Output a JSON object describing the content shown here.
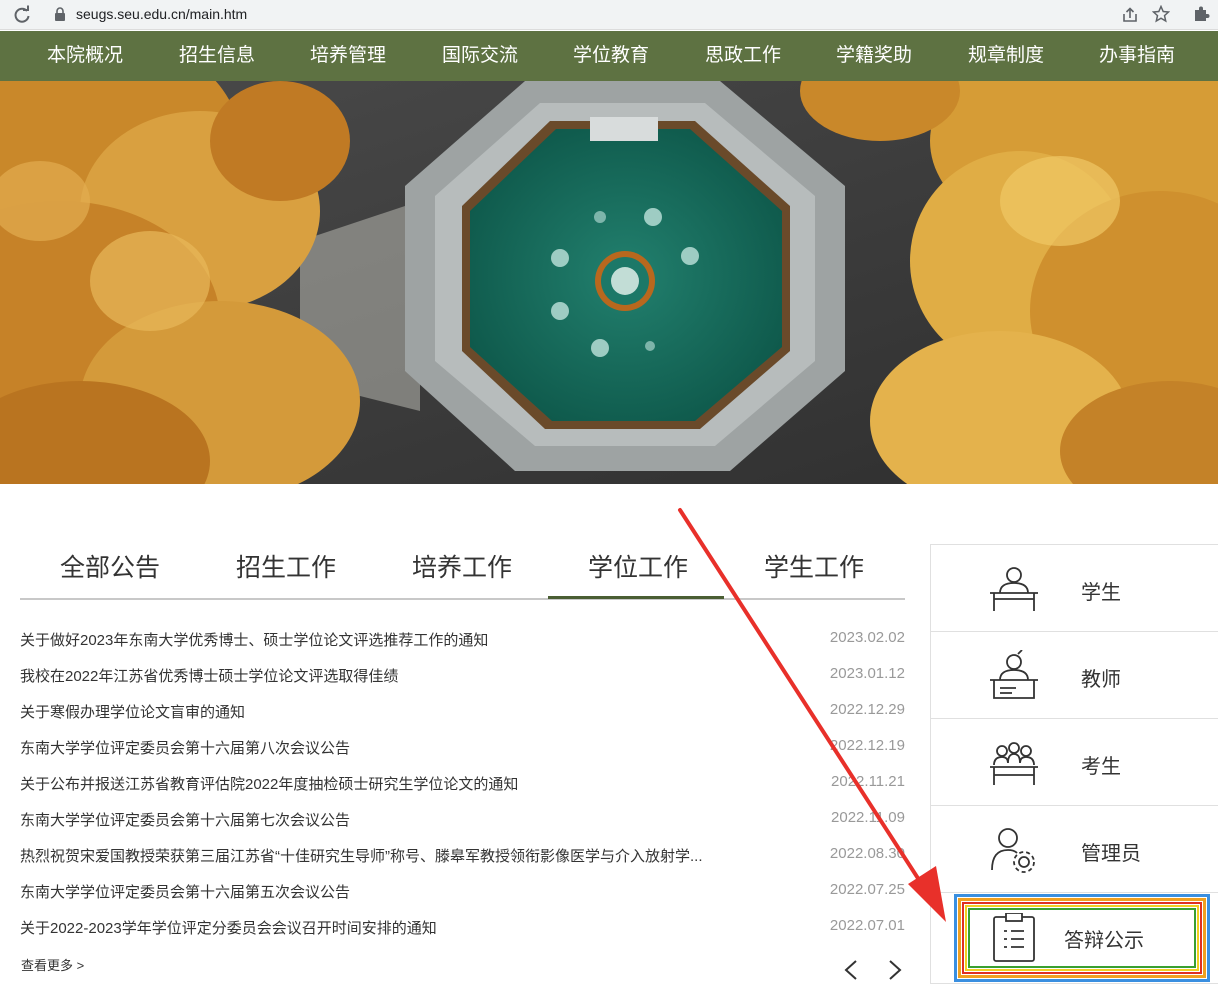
{
  "browser": {
    "url": "seugs.seu.edu.cn/main.htm"
  },
  "nav": {
    "items": [
      "本院概况",
      "招生信息",
      "培养管理",
      "国际交流",
      "学位教育",
      "思政工作",
      "学籍奖助",
      "规章制度",
      "办事指南"
    ]
  },
  "tabs": {
    "items": [
      "全部公告",
      "招生工作",
      "培养工作",
      "学位工作",
      "学生工作"
    ],
    "active": "学位工作"
  },
  "notices": {
    "items": [
      {
        "title": "关于做好2023年东南大学优秀博士、硕士学位论文评选推荐工作的通知",
        "date": "2023.02.02"
      },
      {
        "title": "我校在2022年江苏省优秀博士硕士学位论文评选取得佳绩",
        "date": "2023.01.12"
      },
      {
        "title": "关于寒假办理学位论文盲审的通知",
        "date": "2022.12.29"
      },
      {
        "title": "东南大学学位评定委员会第十六届第八次会议公告",
        "date": "2022.12.19"
      },
      {
        "title": "关于公布并报送江苏省教育评估院2022年度抽检硕士研究生学位论文的通知",
        "date": "2022.11.21"
      },
      {
        "title": "东南大学学位评定委员会第十六届第七次会议公告",
        "date": "2022.11.09"
      },
      {
        "title": "热烈祝贺宋爱国教授荣获第三届江苏省“十佳研究生导师”称号、滕皋军教授领衔影像医学与介入放射学...",
        "date": "2022.08.30"
      },
      {
        "title": "东南大学学位评定委员会第十六届第五次会议公告",
        "date": "2022.07.25"
      },
      {
        "title": "关于2022-2023学年学位评定分委员会会议召开时间安排的通知",
        "date": "2022.07.01"
      }
    ],
    "more": "查看更多 >"
  },
  "panel": {
    "items": [
      {
        "label": "学生",
        "icon": "student-desk-icon"
      },
      {
        "label": "教师",
        "icon": "teacher-desk-icon"
      },
      {
        "label": "考生",
        "icon": "examinees-icon"
      },
      {
        "label": "管理员",
        "icon": "admin-gear-icon"
      },
      {
        "label": "答辩公示",
        "icon": "clipboard-icon"
      }
    ]
  },
  "colors": {
    "nav_bg": "#5e7242",
    "tab_active_underline": "#4a5e33",
    "arrow": "#e8302a",
    "highlight_blue": "#3a8fe0",
    "highlight_orange": "#f0a020",
    "highlight_red": "#e03020",
    "highlight_yellow": "#f0d020",
    "highlight_green": "#3aa030"
  }
}
